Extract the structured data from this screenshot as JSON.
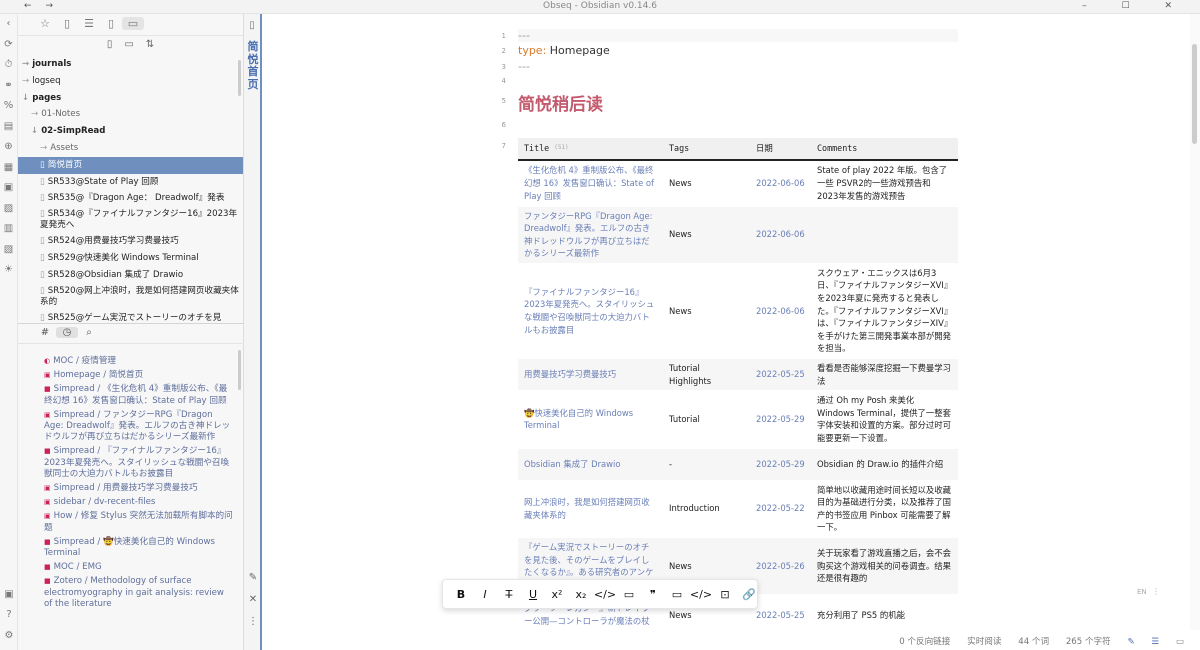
{
  "window": {
    "title": "Obseq - Obsidian v0.14.6",
    "nav_back": "←",
    "nav_forward": "→",
    "controls": "– ☐ ✕"
  },
  "ribbon": {
    "icons": [
      "‹",
      "⟳",
      "⏱",
      "⚭",
      "%",
      "▤",
      "⊕",
      "▦",
      "▣",
      "▨",
      "▥",
      "▧",
      "☀"
    ],
    "bottom_icons": [
      "▣",
      "?",
      "⚙"
    ]
  },
  "left_tabs": {
    "icons": [
      "☆",
      "▯",
      "☰",
      "▯",
      "▭"
    ]
  },
  "file_actions": {
    "icons": [
      "▯",
      "▭",
      "⇅"
    ]
  },
  "file_tree": [
    {
      "label": "journals",
      "prefix": "→",
      "style": "bold",
      "indent": 0
    },
    {
      "label": "logseq",
      "prefix": "→",
      "style": "normal",
      "indent": 0
    },
    {
      "label": "pages",
      "prefix": "↓",
      "style": "bold",
      "indent": 0
    },
    {
      "label": "01-Notes",
      "prefix": "→",
      "style": "dim",
      "indent": 1
    },
    {
      "label": "02-SimpRead",
      "prefix": "↓",
      "style": "bold",
      "indent": 1
    },
    {
      "label": "Assets",
      "prefix": "→",
      "style": "dim",
      "indent": 2
    },
    {
      "label": "简悦首页",
      "prefix": "▯",
      "style": "selected",
      "indent": 2
    },
    {
      "label": "SR533@State of Play 回顾",
      "prefix": "▯",
      "style": "normal",
      "indent": 2
    },
    {
      "label": "SR535@『Dragon Age： Dreadwolf』発表",
      "prefix": "▯",
      "style": "normal",
      "indent": 2
    },
    {
      "label": "SR534@『ファイナルファンタジー16』2023年夏発売へ",
      "prefix": "▯",
      "style": "wrap",
      "indent": 2
    },
    {
      "label": "SR524@用费曼技巧学习费曼技巧",
      "prefix": "▯",
      "style": "normal",
      "indent": 2
    },
    {
      "label": "SR529@快速美化 Windows Terminal",
      "prefix": "▯",
      "style": "normal",
      "indent": 2
    },
    {
      "label": "SR528@Obsidian 集成了 Drawio",
      "prefix": "▯",
      "style": "normal",
      "indent": 2
    },
    {
      "label": "SR520@网上冲浪时，我是如何搭建网页收藏夹体系的",
      "prefix": "▯",
      "style": "wrap",
      "indent": 2
    },
    {
      "label": "SR525@ゲーム実況でストーリーのオチを見",
      "prefix": "▯",
      "style": "normal",
      "indent": 2
    }
  ],
  "panel_tabs": {
    "icons": [
      "#",
      "◷",
      "⌕"
    ]
  },
  "recent_files": [
    {
      "mark": "◐",
      "label": "MOC / 疫情管理"
    },
    {
      "mark": "▣",
      "label": "Homepage / 简悦首页"
    },
    {
      "mark": "■",
      "label": "Simpread / 《生化危机 4》重制版公布、《最终幻想 16》发售窗口确认：State of Play 回顾"
    },
    {
      "mark": "▣",
      "label": "Simpread / ファンタジーRPG『Dragon Age: Dreadwolf』発表。エルフの古き神ドレッドウルフが再び立ちはだかるシリーズ最新作"
    },
    {
      "mark": "■",
      "label": "Simpread / 『ファイナルファンタジー16』2023年夏発売へ。スタイリッシュな戦闘や召喚獣同士の大迫力バトルもお披露目"
    },
    {
      "mark": "▣",
      "label": "Simpread / 用费曼技巧学习费曼技巧"
    },
    {
      "mark": "▣",
      "label": "sidebar / dv-recent-files"
    },
    {
      "mark": "▣",
      "label": "How / 修复 Stylus 突然无法加载所有脚本的问题"
    },
    {
      "mark": "■",
      "label": "Simpread / 🤠快速美化自己的 Windows Terminal"
    },
    {
      "mark": "■",
      "label": "MOC / EMG"
    },
    {
      "mark": "■",
      "label": "Zotero / Methodology of surface electromyography in gait analysis: review of the literature"
    }
  ],
  "left_footer": {
    "edit_icon": "✎",
    "close_icon": "✕",
    "more_icon": "⋮"
  },
  "vertical_tab": {
    "icon": "▯",
    "title": "简悦首页"
  },
  "editor": {
    "line_numbers": [
      "1",
      "2",
      "3",
      "4",
      "5",
      "6",
      "7"
    ],
    "fm_open": "---",
    "fm_key": "type:",
    "fm_value": "Homepage",
    "fm_close": "---",
    "heading": "简悦稍后读"
  },
  "table": {
    "headers": {
      "title": "Title",
      "count": "(51)",
      "tags": "Tags",
      "date": "日期",
      "comments": "Comments"
    },
    "rows": [
      {
        "title": "《生化危机 4》重制版公布、《最终幻想 16》发售窗口确认：State of Play 回顾",
        "tags": "News",
        "date": "2022-06-06",
        "comment": "State of play 2022 年版。包含了一些 PSVR2的一些游戏预告和 2023年发售的游戏预告"
      },
      {
        "title": "ファンタジーRPG『Dragon Age: Dreadwolf』発表。エルフの古き神ドレッドウルフが再び立ちはだかるシリーズ最新作",
        "tags": "News",
        "date": "2022-06-06",
        "comment": ""
      },
      {
        "title": "『ファイナルファンタジー16』2023年夏発売へ。スタイリッシュな戦闘や召喚獣同士の大迫力バトルもお披露目",
        "tags": "News",
        "date": "2022-06-06",
        "comment": "スクウェア・エニックスは6月3日、『ファイナルファンタジーXVI』を2023年夏に発売すると発表した。『ファイナルファンタジーXVI』は、『ファイナルファンタジーXIV』を手がけた第三開発事業本部が開発を担当。"
      },
      {
        "title": "用费曼技巧学习费曼技巧",
        "tags": "Tutorial Highlights",
        "date": "2022-05-25",
        "comment": "看看是否能够深度挖掘一下费曼学习法"
      },
      {
        "title": "🤠快速美化自己的 Windows Terminal",
        "tags": "Tutorial",
        "date": "2022-05-29",
        "comment": "通过 Oh my Posh 来美化 Windows Terminal，提供了一整套字体安装和设置的方案。部分过时可能要更新一下设置。"
      },
      {
        "title": "Obsidian 集成了 Drawio",
        "tags": "-",
        "date": "2022-05-29",
        "comment": "Obsidian 的 Draw.io 的插件介绍"
      },
      {
        "title": "网上冲浪时，我是如何搭建网页收藏夹体系的",
        "tags": "Introduction",
        "date": "2022-05-22",
        "comment": "简单地以收藏用途时间长短以及收藏目的为基础进行分类，以及推荐了国产的书签应用 Pinbox 可能需要了解一下。"
      },
      {
        "title": "『ゲーム実況でストーリーのオチを見た後、そのゲームをプレイしたくなるか』。ある研究者のアンケートが反響。その結果は",
        "tags": "News",
        "date": "2022-05-26",
        "comment": "关于玩家看了游戏直播之后，会不会购买这个游戏相关的问卷调查。结果还是很有趣的"
      },
      {
        "title": "グワーツ・レガシー』新トレイラー公開—コントローラが魔法の杖",
        "tags": "News",
        "date": "2022-05-25",
        "comment": "充分利用了 PS5 的机能"
      }
    ]
  },
  "format_toolbar": {
    "buttons": [
      "B",
      "I",
      "T̶",
      "U",
      "x²",
      "x₂",
      "</>",
      "▭",
      "❞",
      "▭",
      "</>",
      "⊡",
      "🔗"
    ]
  },
  "status_bar": {
    "backlinks": "0 个反向链接",
    "mode": "实时阅读",
    "words": "44 个词",
    "chars": "265 个字符"
  },
  "lang_indicator": {
    "text": "EN",
    "extra": "⋮"
  }
}
